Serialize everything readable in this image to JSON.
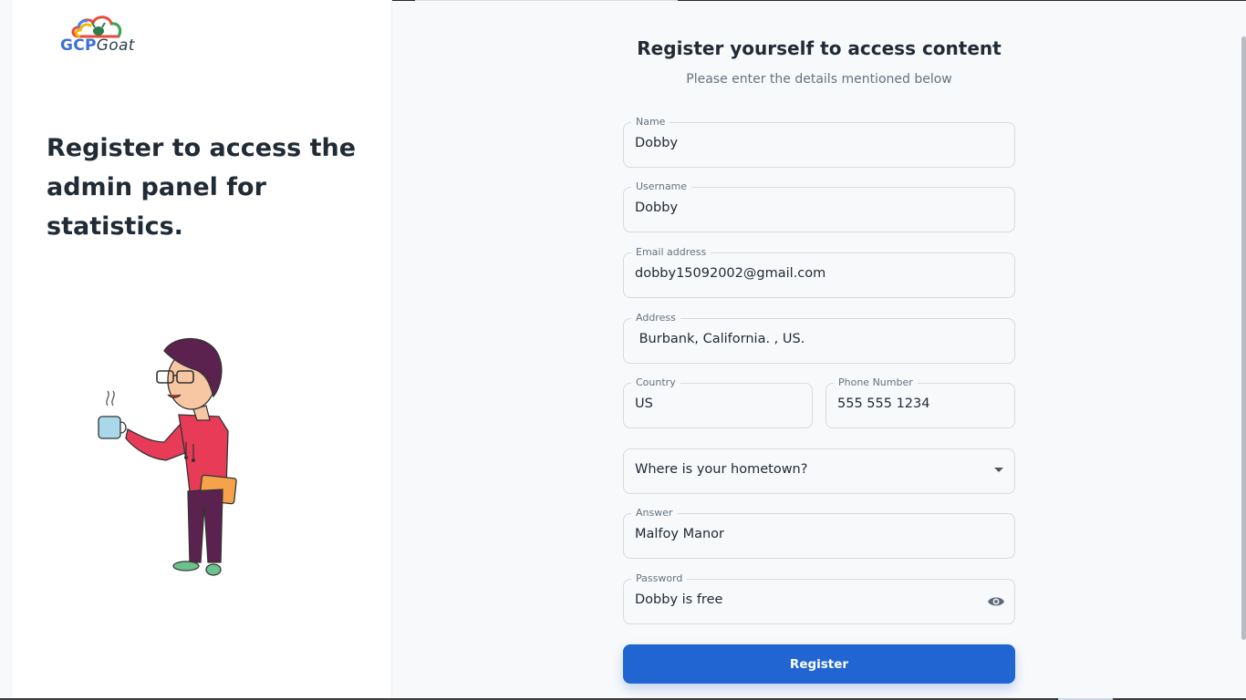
{
  "brand": {
    "logo_prefix": "GCP",
    "logo_suffix": "Goat"
  },
  "hero": {
    "headline": "Register to access the admin panel for statistics."
  },
  "form": {
    "title": "Register yourself to access content",
    "subtitle": "Please enter the details mentioned below",
    "fields": {
      "name": {
        "label": "Name",
        "value": "Dobby"
      },
      "username": {
        "label": "Username",
        "value": "Dobby"
      },
      "email": {
        "label": "Email address",
        "value": "dobby15092002@gmail.com"
      },
      "address": {
        "label": "Address",
        "value": " Burbank, California. , US."
      },
      "country": {
        "label": "Country",
        "value": "US"
      },
      "phone": {
        "label": "Phone Number",
        "value": "555 555 1234"
      },
      "security_question": {
        "value": "Where is your hometown?"
      },
      "answer": {
        "label": "Answer",
        "value": "Malfoy Manor"
      },
      "password": {
        "label": "Password",
        "value": "Dobby is free"
      }
    },
    "submit_label": "Register"
  },
  "icons": {
    "logo": "cloud-goat-icon",
    "select": "chevron-down-icon",
    "password_toggle": "eye-icon",
    "illustration": "person-with-coffee-illustration"
  },
  "colors": {
    "primary": "#2065d1",
    "heading": "#212b36",
    "muted": "#637381",
    "background": "#f8f9fb",
    "panel": "#ffffff"
  }
}
